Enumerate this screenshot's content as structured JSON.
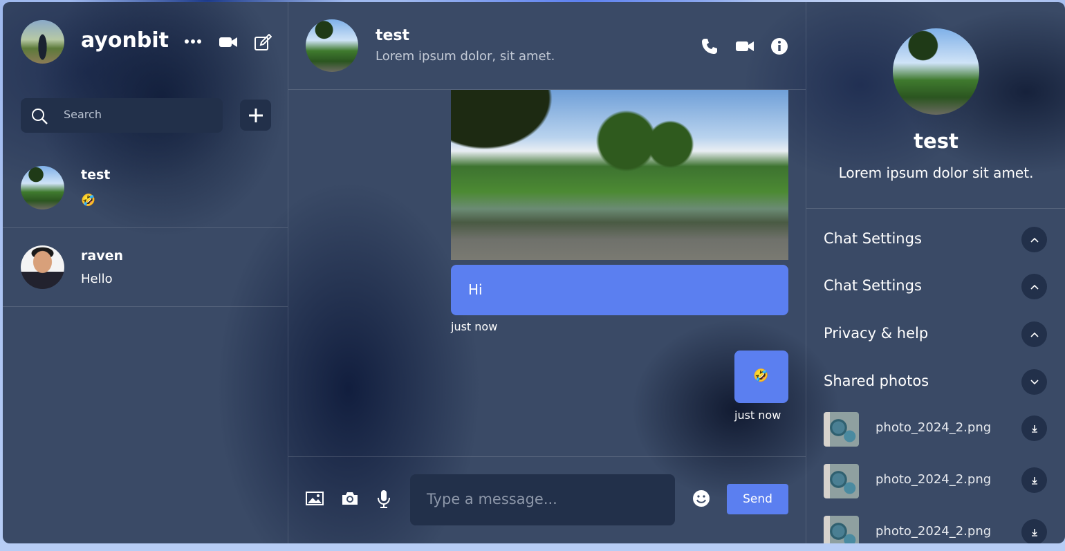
{
  "user": {
    "name": "ayonbit"
  },
  "search": {
    "placeholder": "Search"
  },
  "chats": [
    {
      "name": "test",
      "last_message": "🤣"
    },
    {
      "name": "raven",
      "last_message": "Hello"
    }
  ],
  "conversation": {
    "name": "test",
    "status": "Lorem ipsum dolor, sit amet.",
    "messages": [
      {
        "type": "text",
        "text": "Hi",
        "time": "just now"
      },
      {
        "type": "text",
        "text": "🤣",
        "time": "just now"
      }
    ]
  },
  "composer": {
    "placeholder": "Type a message...",
    "send_label": "Send"
  },
  "details": {
    "name": "test",
    "description": "Lorem ipsum dolor sit amet.",
    "sections": [
      {
        "label": "Chat Settings",
        "state": "collapsed"
      },
      {
        "label": "Chat Settings",
        "state": "collapsed"
      },
      {
        "label": "Privacy & help",
        "state": "collapsed"
      },
      {
        "label": "Shared photos",
        "state": "expanded"
      }
    ],
    "photos": [
      {
        "name": "photo_2024_2.png"
      },
      {
        "name": "photo_2024_2.png"
      },
      {
        "name": "photo_2024_2.png"
      }
    ]
  },
  "colors": {
    "accent": "#5b7ff0",
    "panel": "#3a4a66",
    "input_bg": "#22304a"
  },
  "icons": [
    "search-icon",
    "ellipsis-icon",
    "video-icon",
    "edit-icon",
    "plus-icon",
    "phone-icon",
    "info-icon",
    "image-icon",
    "camera-icon",
    "mic-icon",
    "emoji-icon",
    "chevron-up-icon",
    "chevron-down-icon",
    "download-icon"
  ]
}
